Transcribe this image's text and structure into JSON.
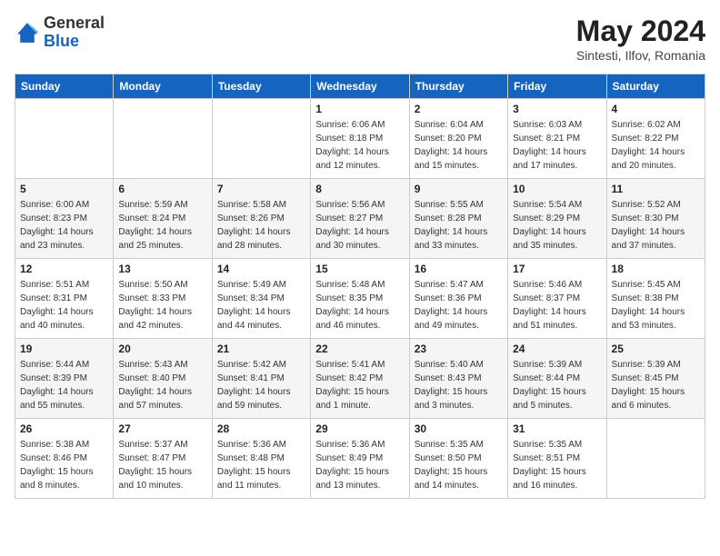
{
  "header": {
    "logo_general": "General",
    "logo_blue": "Blue",
    "month_year": "May 2024",
    "location": "Sintesti, Ilfov, Romania"
  },
  "weekdays": [
    "Sunday",
    "Monday",
    "Tuesday",
    "Wednesday",
    "Thursday",
    "Friday",
    "Saturday"
  ],
  "weeks": [
    [
      {
        "day": "",
        "info": ""
      },
      {
        "day": "",
        "info": ""
      },
      {
        "day": "",
        "info": ""
      },
      {
        "day": "1",
        "info": "Sunrise: 6:06 AM\nSunset: 8:18 PM\nDaylight: 14 hours\nand 12 minutes."
      },
      {
        "day": "2",
        "info": "Sunrise: 6:04 AM\nSunset: 8:20 PM\nDaylight: 14 hours\nand 15 minutes."
      },
      {
        "day": "3",
        "info": "Sunrise: 6:03 AM\nSunset: 8:21 PM\nDaylight: 14 hours\nand 17 minutes."
      },
      {
        "day": "4",
        "info": "Sunrise: 6:02 AM\nSunset: 8:22 PM\nDaylight: 14 hours\nand 20 minutes."
      }
    ],
    [
      {
        "day": "5",
        "info": "Sunrise: 6:00 AM\nSunset: 8:23 PM\nDaylight: 14 hours\nand 23 minutes."
      },
      {
        "day": "6",
        "info": "Sunrise: 5:59 AM\nSunset: 8:24 PM\nDaylight: 14 hours\nand 25 minutes."
      },
      {
        "day": "7",
        "info": "Sunrise: 5:58 AM\nSunset: 8:26 PM\nDaylight: 14 hours\nand 28 minutes."
      },
      {
        "day": "8",
        "info": "Sunrise: 5:56 AM\nSunset: 8:27 PM\nDaylight: 14 hours\nand 30 minutes."
      },
      {
        "day": "9",
        "info": "Sunrise: 5:55 AM\nSunset: 8:28 PM\nDaylight: 14 hours\nand 33 minutes."
      },
      {
        "day": "10",
        "info": "Sunrise: 5:54 AM\nSunset: 8:29 PM\nDaylight: 14 hours\nand 35 minutes."
      },
      {
        "day": "11",
        "info": "Sunrise: 5:52 AM\nSunset: 8:30 PM\nDaylight: 14 hours\nand 37 minutes."
      }
    ],
    [
      {
        "day": "12",
        "info": "Sunrise: 5:51 AM\nSunset: 8:31 PM\nDaylight: 14 hours\nand 40 minutes."
      },
      {
        "day": "13",
        "info": "Sunrise: 5:50 AM\nSunset: 8:33 PM\nDaylight: 14 hours\nand 42 minutes."
      },
      {
        "day": "14",
        "info": "Sunrise: 5:49 AM\nSunset: 8:34 PM\nDaylight: 14 hours\nand 44 minutes."
      },
      {
        "day": "15",
        "info": "Sunrise: 5:48 AM\nSunset: 8:35 PM\nDaylight: 14 hours\nand 46 minutes."
      },
      {
        "day": "16",
        "info": "Sunrise: 5:47 AM\nSunset: 8:36 PM\nDaylight: 14 hours\nand 49 minutes."
      },
      {
        "day": "17",
        "info": "Sunrise: 5:46 AM\nSunset: 8:37 PM\nDaylight: 14 hours\nand 51 minutes."
      },
      {
        "day": "18",
        "info": "Sunrise: 5:45 AM\nSunset: 8:38 PM\nDaylight: 14 hours\nand 53 minutes."
      }
    ],
    [
      {
        "day": "19",
        "info": "Sunrise: 5:44 AM\nSunset: 8:39 PM\nDaylight: 14 hours\nand 55 minutes."
      },
      {
        "day": "20",
        "info": "Sunrise: 5:43 AM\nSunset: 8:40 PM\nDaylight: 14 hours\nand 57 minutes."
      },
      {
        "day": "21",
        "info": "Sunrise: 5:42 AM\nSunset: 8:41 PM\nDaylight: 14 hours\nand 59 minutes."
      },
      {
        "day": "22",
        "info": "Sunrise: 5:41 AM\nSunset: 8:42 PM\nDaylight: 15 hours\nand 1 minute."
      },
      {
        "day": "23",
        "info": "Sunrise: 5:40 AM\nSunset: 8:43 PM\nDaylight: 15 hours\nand 3 minutes."
      },
      {
        "day": "24",
        "info": "Sunrise: 5:39 AM\nSunset: 8:44 PM\nDaylight: 15 hours\nand 5 minutes."
      },
      {
        "day": "25",
        "info": "Sunrise: 5:39 AM\nSunset: 8:45 PM\nDaylight: 15 hours\nand 6 minutes."
      }
    ],
    [
      {
        "day": "26",
        "info": "Sunrise: 5:38 AM\nSunset: 8:46 PM\nDaylight: 15 hours\nand 8 minutes."
      },
      {
        "day": "27",
        "info": "Sunrise: 5:37 AM\nSunset: 8:47 PM\nDaylight: 15 hours\nand 10 minutes."
      },
      {
        "day": "28",
        "info": "Sunrise: 5:36 AM\nSunset: 8:48 PM\nDaylight: 15 hours\nand 11 minutes."
      },
      {
        "day": "29",
        "info": "Sunrise: 5:36 AM\nSunset: 8:49 PM\nDaylight: 15 hours\nand 13 minutes."
      },
      {
        "day": "30",
        "info": "Sunrise: 5:35 AM\nSunset: 8:50 PM\nDaylight: 15 hours\nand 14 minutes."
      },
      {
        "day": "31",
        "info": "Sunrise: 5:35 AM\nSunset: 8:51 PM\nDaylight: 15 hours\nand 16 minutes."
      },
      {
        "day": "",
        "info": ""
      }
    ]
  ]
}
